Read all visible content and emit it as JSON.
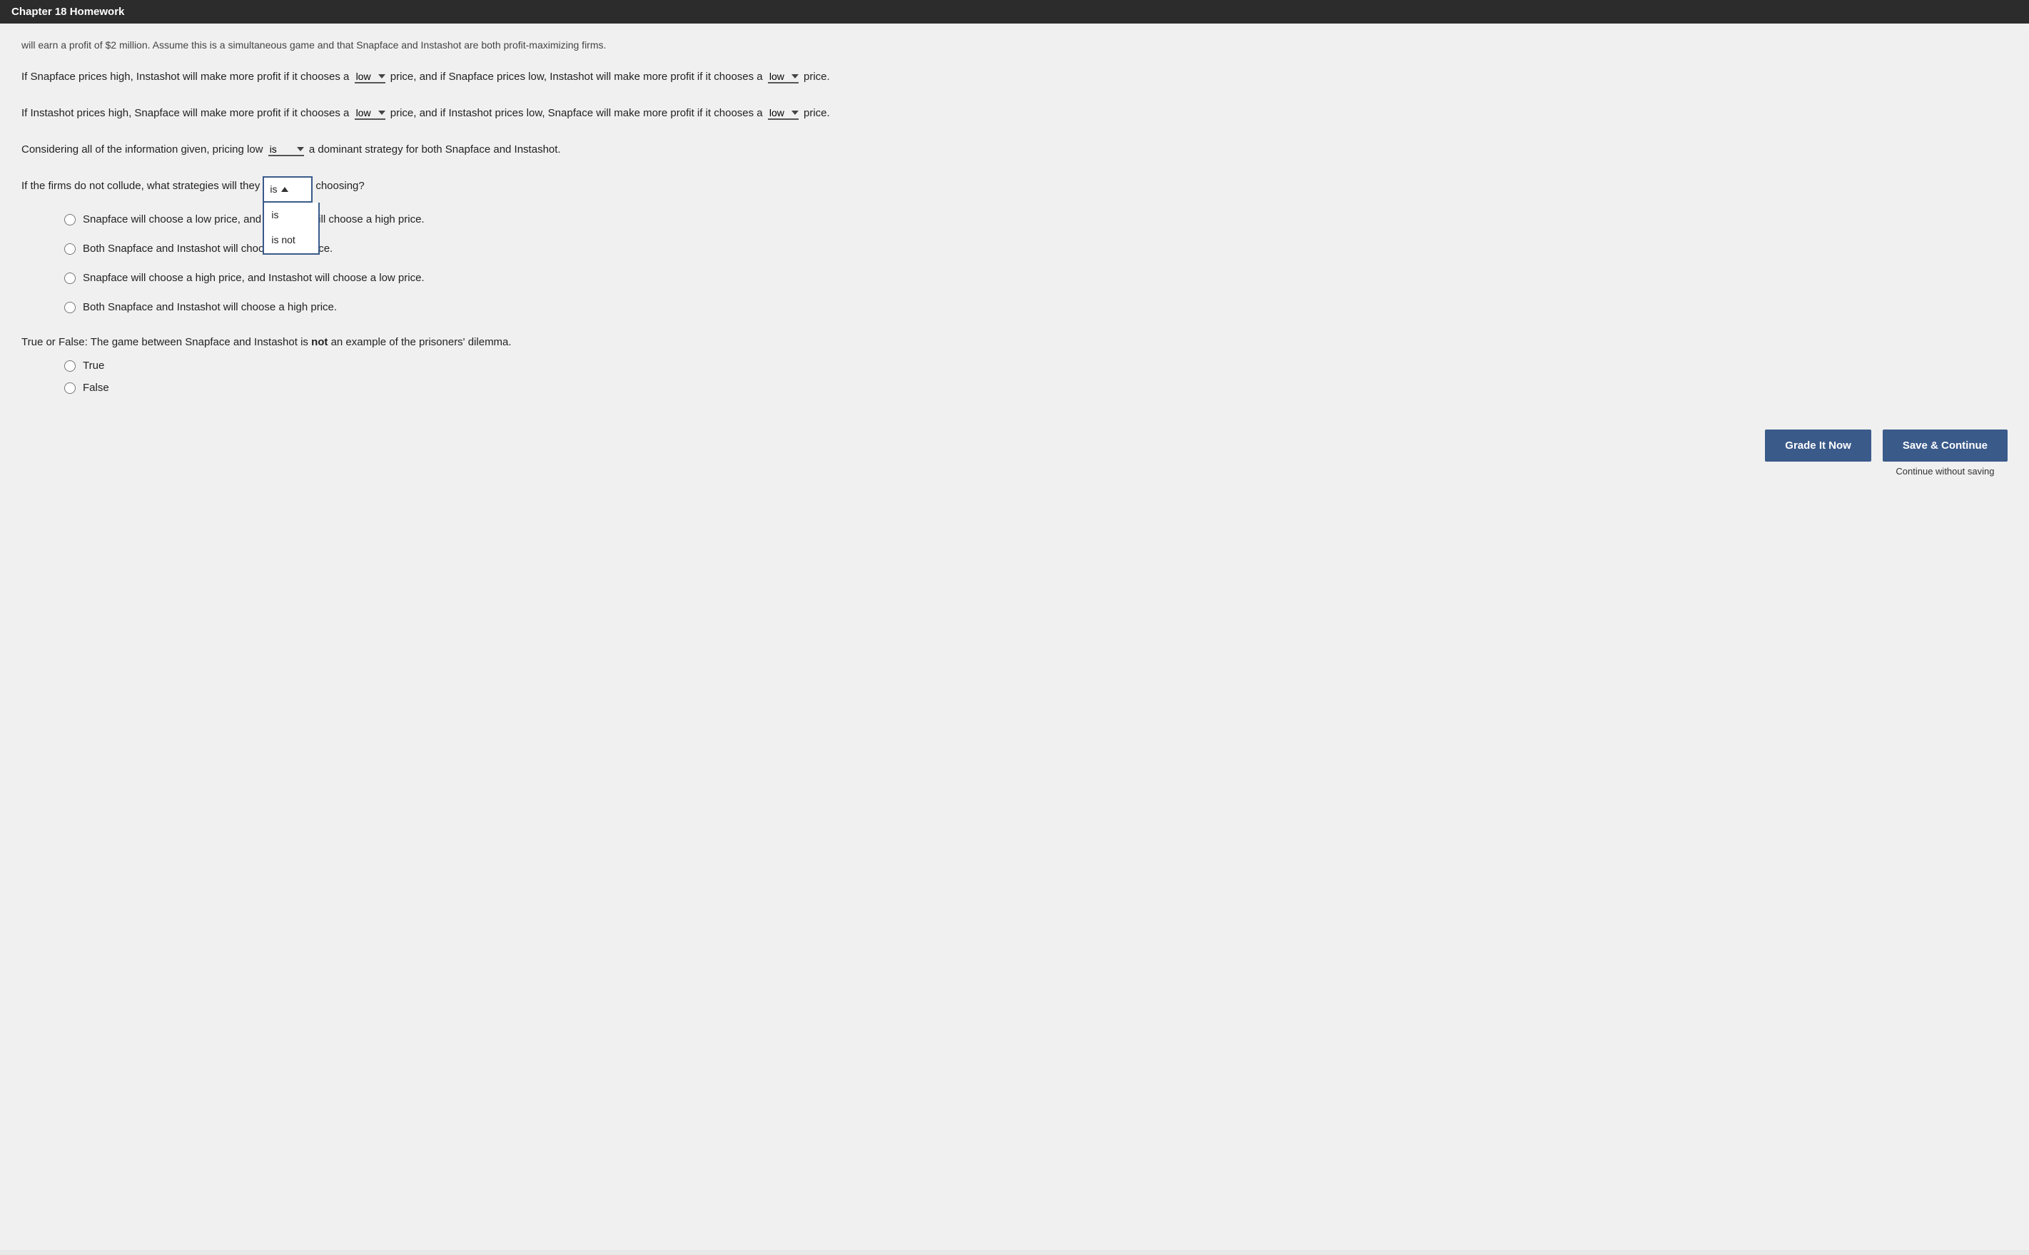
{
  "header": {
    "title": "Chapter 18 Homework"
  },
  "intro": {
    "text": "will earn a profit of $2 million. Assume this is a simultaneous game and that Snapface and Instashot are both profit-maximizing firms."
  },
  "question1": {
    "prefix": "If Snapface prices high, Instashot will make more profit if it chooses a",
    "dropdown1_label": "▼",
    "mid": "price, and if Snapface prices low, Instashot will make more profit if it chooses a",
    "dropdown2_label": "▼",
    "suffix": "price."
  },
  "question2": {
    "prefix": "If Instashot prices high, Snapface will make more profit if it chooses a",
    "dropdown1_label": "▼",
    "mid": "price, and if Instashot prices low, Snapface will make more profit if it chooses a",
    "dropdown2_label": "▼",
    "suffix": "price."
  },
  "question3": {
    "prefix": "Considering all of the information given, pricing low",
    "dropdown_label": "▼",
    "suffix": "a dominant strategy for both Snapface and Instashot."
  },
  "question4": {
    "prefix": "If the firms do not collude, what strategies will they",
    "dropdown_open_value": "is",
    "dropdown_options": [
      "is",
      "is not"
    ],
    "suffix": "choosing?",
    "options": [
      "Snapface will choose a low price, and Instashot will choose a high price.",
      "Both Snapface and Instashot will choose a low price.",
      "Snapface will choose a high price, and Instashot will choose a low price.",
      "Both Snapface and Instashot will choose a high price."
    ]
  },
  "question5": {
    "prefix": "True or False: The game between Snapface and Instashot is",
    "bold_word": "not",
    "suffix": "an example of the prisoners' dilemma.",
    "options": [
      "True",
      "False"
    ]
  },
  "buttons": {
    "grade_label": "Grade It Now",
    "save_label": "Save & Continue",
    "continue_label": "Continue without saving"
  }
}
